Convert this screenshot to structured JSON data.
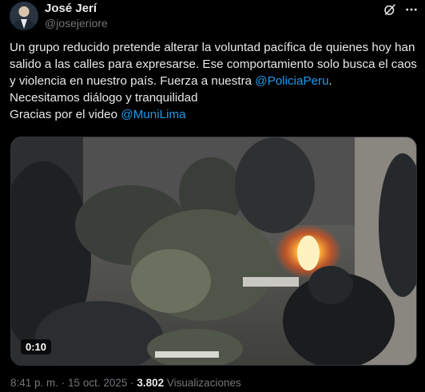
{
  "author": {
    "name": "José Jerí",
    "handle": "@josejeriore",
    "avatar_icon": "profile-photo"
  },
  "actions": {
    "grok_icon": "grok-icon",
    "more_icon": "more-icon"
  },
  "tweet": {
    "line1_part1": "Un grupo reducido pretende alterar la voluntad pacífica de quienes hoy han salido a las calles para expresarse.  Ese comportamiento solo busca el caos y violencia en nuestro país. Fuerza a nuestra ",
    "mention1": "@PoliciaPeru",
    "line1_part2": ".\nNecesitamos diálogo y tranquilidad\nGracias por el video ",
    "mention2": "@MuniLima"
  },
  "media": {
    "type": "video",
    "duration": "0:10"
  },
  "meta": {
    "time": "8:41 p. m.",
    "separator1": " · ",
    "date": "15 oct. 2025",
    "separator2": " · ",
    "views": "3.802",
    "views_label": " Visualizaciones"
  },
  "colors": {
    "background": "#000000",
    "text": "#e7e9ea",
    "secondary": "#71767b",
    "link": "#1d9bf0"
  }
}
